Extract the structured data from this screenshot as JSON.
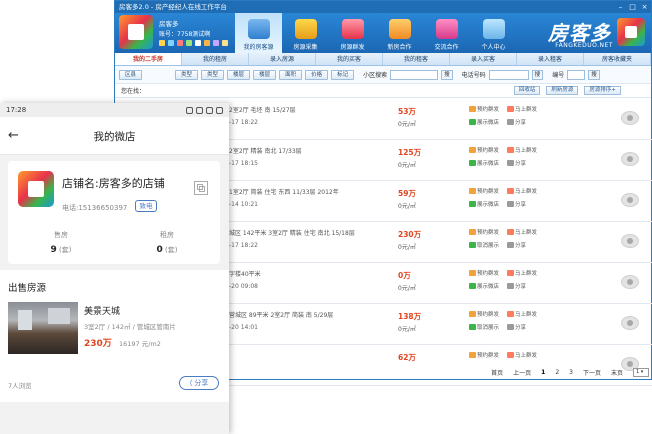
{
  "window": {
    "title": "房客多2.0 - 房产经纪人在线工作平台",
    "user_name": "房客多",
    "user_account": "账号：7758测试啊",
    "brand": "房客多",
    "brand_sub": "FANGKEDUO.NET",
    "top_nav": [
      "我的房客源",
      "房源采集",
      "房源群发",
      "新房合作",
      "交流合作",
      "个人中心"
    ],
    "tabs": [
      "我的二手房",
      "我的租房",
      "录入房源",
      "我的买客",
      "我的租客",
      "录入买客",
      "录入租客",
      "房客收藏夹"
    ],
    "filters": [
      "区县",
      "类型",
      "类型",
      "楼层",
      "楼层",
      "面积",
      "价格",
      "标记"
    ],
    "search_label": "小区搜索",
    "search_btn": "搜",
    "phone_label": "电话号码",
    "phone_btn": "搜",
    "number_label": "编号",
    "number_btn": "搜",
    "location_label": "您在找：",
    "loc_buttons": [
      "回收站",
      "刷新房源",
      "房源排序+"
    ],
    "listings": [
      {
        "desc": "2室2厅  毛坯   南  15/27层",
        "time": "-17 18:22",
        "price": "53万",
        "unit": "0元/㎡",
        "a1": "预约群发",
        "a2": "马上群发",
        "a3": "展示微店",
        "a4": "分享"
      },
      {
        "desc": "2室2厅  精装   南北  17/33层",
        "time": "-17 18:15",
        "price": "125万",
        "unit": "0元/㎡",
        "a1": "预约群发",
        "a2": "马上群发",
        "a3": "展示微店",
        "a4": "分享"
      },
      {
        "desc": "1室2厅  简装  住宅  东西  11/33层  2012年",
        "time": "-14 10:21",
        "price": "59万",
        "unit": "0元/㎡",
        "a1": "预约群发",
        "a2": "马上群发",
        "a3": "展示微店",
        "a4": "分享"
      },
      {
        "desc": "城区  142平米  3室2厅  精装  住宅  南北  15/18层",
        "time": "-17 18:22",
        "price": "230万",
        "unit": "0元/㎡",
        "a1": "预约群发",
        "a2": "马上群发",
        "a3": "取消展示",
        "a4": "分享"
      },
      {
        "desc": "字楼40平米",
        "time": "-20 09:08",
        "price": "0万",
        "unit": "0元/㎡",
        "a1": "预约群发",
        "a2": "马上群发",
        "a3": "展示微店",
        "a4": "分享"
      },
      {
        "desc": "营城区  89平米  2室2厅  简装  南  5/29层",
        "time": "-20 14:01",
        "price": "138万",
        "unit": "0元/㎡",
        "a1": "预约群发",
        "a2": "马上群发",
        "a3": "取消展示",
        "a4": "分享"
      },
      {
        "desc": "",
        "time": "",
        "price": "62万",
        "unit": "",
        "a1": "预约群发",
        "a2": "马上群发",
        "a3": "",
        "a4": ""
      }
    ],
    "pager": {
      "first": "首页",
      "prev": "上一页",
      "p1": "1",
      "p2": "2",
      "p3": "3",
      "next": "下一页",
      "last": "末页",
      "select": "1"
    }
  },
  "phone": {
    "time": "17:28",
    "title": "我的微店",
    "shop_name": "店铺名:房客多的店铺",
    "shop_phone": "电话:15136650397",
    "call_btn": "致电",
    "sale_label": "售房",
    "sale_count": "9",
    "sale_unit": "(套)",
    "rent_label": "租房",
    "rent_count": "0",
    "rent_unit": "(套)",
    "section_title": "出售房源",
    "house_name": "美景天城",
    "house_spec": "3室2厅 / 142㎡ / 管城区管南片",
    "house_price": "230万",
    "house_unit_price": "16197 元/m2",
    "views": "7人浏览",
    "share": "分享"
  },
  "colors": {
    "title_bar": "#1f6db4",
    "header": "#2a86d6",
    "price": "#e0451f",
    "link_blue": "#4c7cc6"
  }
}
